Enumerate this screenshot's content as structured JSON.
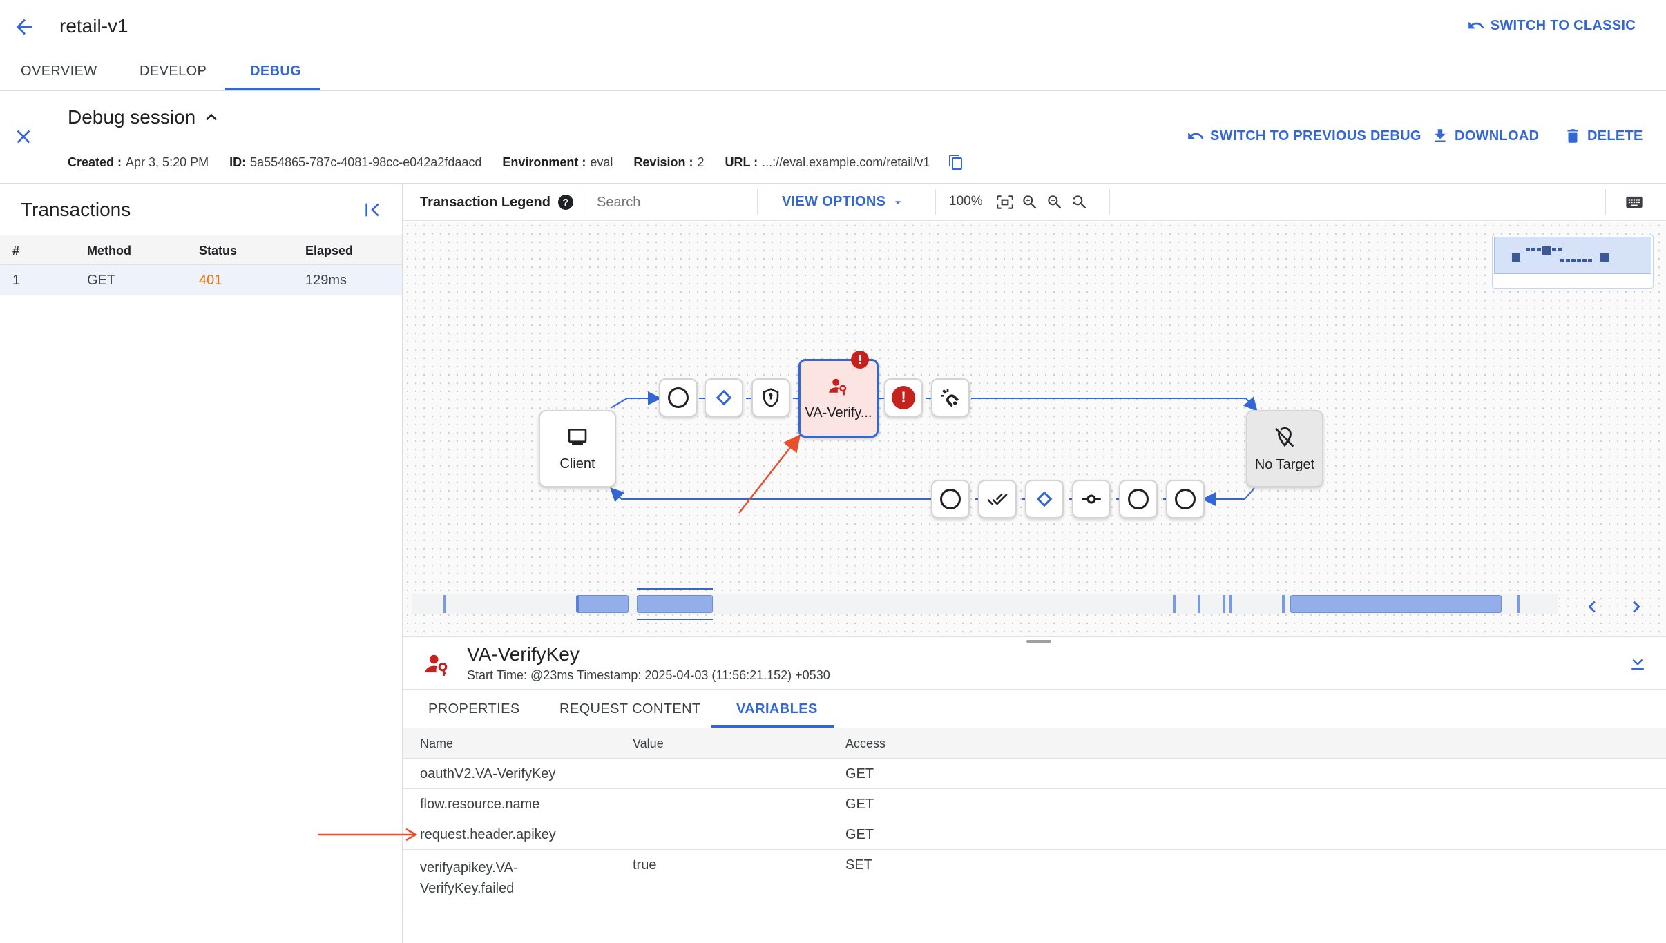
{
  "header": {
    "title": "retail-v1",
    "switch_classic": "SWITCH TO CLASSIC"
  },
  "tabs": [
    "OVERVIEW",
    "DEVELOP",
    "DEBUG"
  ],
  "session": {
    "title": "Debug session",
    "created_label": "Created :",
    "created": "Apr 3, 5:20 PM",
    "id_label": "ID:",
    "id": "5a554865-787c-4081-98cc-e042a2fdaacd",
    "env_label": "Environment :",
    "env": "eval",
    "rev_label": "Revision :",
    "rev": "2",
    "url_label": "URL :",
    "url": "...://eval.example.com/retail/v1",
    "switch_prev": "SWITCH TO PREVIOUS DEBUG",
    "download": "DOWNLOAD",
    "delete": "DELETE"
  },
  "transactions": {
    "title": "Transactions",
    "columns": [
      "#",
      "Method",
      "Status",
      "Elapsed"
    ],
    "rows": [
      {
        "num": "1",
        "method": "GET",
        "status": "401",
        "elapsed": "129ms"
      }
    ]
  },
  "toolbar": {
    "legend": "Transaction Legend",
    "search_placeholder": "Search",
    "view_options": "VIEW OPTIONS",
    "zoom": "100%"
  },
  "flow": {
    "client_label": "Client",
    "policy_label": "VA-Verify...",
    "target_label": "No Target"
  },
  "detail": {
    "title": "VA-VerifyKey",
    "subtitle": "Start Time: @23ms Timestamp: 2025-04-03 (11:56:21.152) +0530",
    "tabs": [
      "PROPERTIES",
      "REQUEST CONTENT",
      "VARIABLES"
    ],
    "columns": [
      "Name",
      "Value",
      "Access"
    ],
    "rows": [
      {
        "name": "oauthV2.VA-VerifyKey",
        "value": "",
        "access": "GET"
      },
      {
        "name": "flow.resource.name",
        "value": "",
        "access": "GET"
      },
      {
        "name": "request.header.apikey",
        "value": "",
        "access": "GET"
      },
      {
        "name": "verifyapikey.VA-VerifyKey.failed",
        "value": "true",
        "access": "SET"
      }
    ],
    "row4_line1": "verifyapikey.VA-",
    "row4_line2": "VerifyKey.failed"
  },
  "colors": {
    "accent": "#3367d6",
    "error": "#c5221f",
    "status_401": "#e8710a",
    "annotation": "#e8502d"
  }
}
